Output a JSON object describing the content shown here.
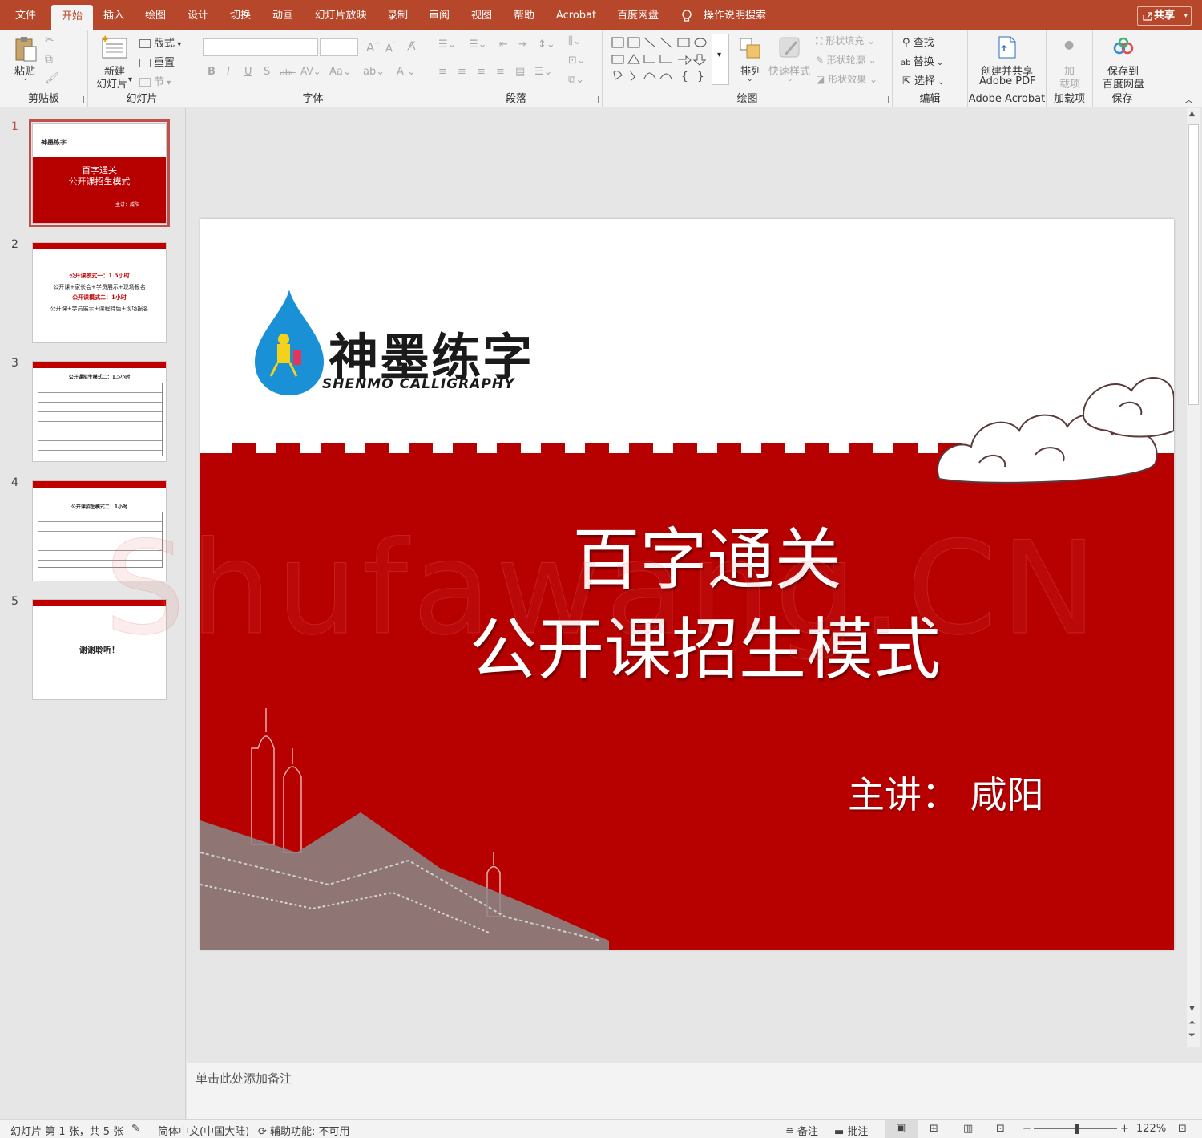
{
  "tabs": [
    {
      "label": "文件"
    },
    {
      "label": "开始"
    },
    {
      "label": "插入"
    },
    {
      "label": "绘图"
    },
    {
      "label": "设计"
    },
    {
      "label": "切换"
    },
    {
      "label": "动画"
    },
    {
      "label": "幻灯片放映"
    },
    {
      "label": "录制"
    },
    {
      "label": "审阅"
    },
    {
      "label": "视图"
    },
    {
      "label": "帮助"
    },
    {
      "label": "Acrobat"
    },
    {
      "label": "百度网盘"
    }
  ],
  "tell_me": "操作说明搜索",
  "share": "共享",
  "ribbon": {
    "clipboard": {
      "paste": "粘贴",
      "group": "剪贴板"
    },
    "slides": {
      "new_slide_1": "新建",
      "new_slide_2": "幻灯片",
      "layout": "版式",
      "reset": "重置",
      "section": "节",
      "group": "幻灯片"
    },
    "font": {
      "group": "字体"
    },
    "paragraph": {
      "group": "段落"
    },
    "drawing": {
      "arrange": "排列",
      "quick_styles": "快速样式",
      "fill": "形状填充",
      "outline": "形状轮廓",
      "effects": "形状效果",
      "group": "绘图"
    },
    "editing": {
      "find": "查找",
      "replace": "替换",
      "select": "选择",
      "group": "编辑"
    },
    "acrobat": {
      "create_1": "创建并共享",
      "create_2": "Adobe PDF",
      "group": "Adobe Acrobat"
    },
    "addins": {
      "label_1": "加",
      "label_2": "载项",
      "group": "加载项"
    },
    "save": {
      "label_1": "保存到",
      "label_2": "百度网盘",
      "group": "保存"
    }
  },
  "thumbnails": [
    {
      "num": "1",
      "line1": "百字通关",
      "line2": "公开课招生模式",
      "line3": "主讲：咸阳",
      "logo": "神墨练字"
    },
    {
      "num": "2",
      "line1": "公开课模式一：1.5小时",
      "line2": "公开课+家长会+学员展示+现场报名",
      "line3": "公开课模式二：1小时",
      "line4": "公开课+学员展示+课程特色+现场报名"
    },
    {
      "num": "3",
      "line1": "公开课招生模式二：1.5小时"
    },
    {
      "num": "4",
      "line1": "公开课招生模式二：1小时"
    },
    {
      "num": "5",
      "line1": "谢谢聆听！"
    }
  ],
  "slide": {
    "logo_cn": "神墨练字",
    "logo_en": "SHENMO CALLIGRAPHY",
    "title_line1": "百字通关",
    "title_line2": "公开课招生模式",
    "presenter": "主讲：  咸阳"
  },
  "watermark": "Shufawang.CN",
  "notes_placeholder": "单击此处添加备注",
  "status": {
    "slide_info": "幻灯片 第 1 张，共 5 张",
    "language": "简体中文(中国大陆)",
    "accessibility": "辅助功能: 不可用",
    "notes": "备注",
    "comments": "批注",
    "zoom": "122%"
  },
  "colors": {
    "accent": "#b7472a",
    "slide_red": "#b70000"
  }
}
